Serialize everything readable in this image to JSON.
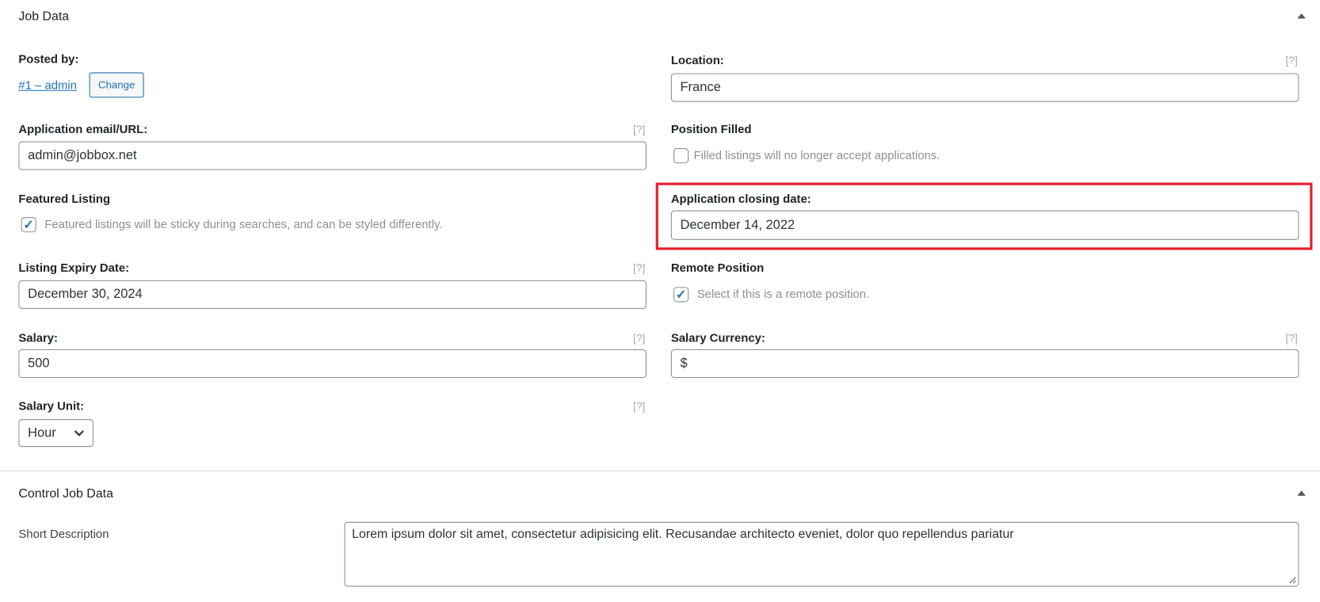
{
  "job_data": {
    "title": "Job Data",
    "posted_by": {
      "label": "Posted by:",
      "user_link": "#1 – admin",
      "change_button": "Change"
    },
    "location": {
      "label": "Location:",
      "help": "[?]",
      "value": "France"
    },
    "application": {
      "label": "Application email/URL:",
      "help": "[?]",
      "value": "admin@jobbox.net"
    },
    "position_filled": {
      "label": "Position Filled",
      "checked": false,
      "description": "Filled listings will no longer accept applications."
    },
    "featured": {
      "label": "Featured Listing",
      "checked": true,
      "description": "Featured listings will be sticky during searches, and can be styled differently."
    },
    "closing_date": {
      "label": "Application closing date:",
      "value": "December 14, 2022",
      "highlight_color": "#e8202a"
    },
    "expiry": {
      "label": "Listing Expiry Date:",
      "help": "[?]",
      "value": "December 30, 2024"
    },
    "remote": {
      "label": "Remote Position",
      "checked": true,
      "description": "Select if this is a remote position."
    },
    "salary": {
      "label": "Salary:",
      "help": "[?]",
      "value": "500"
    },
    "currency": {
      "label": "Salary Currency:",
      "help": "[?]",
      "value": "$"
    },
    "unit": {
      "label": "Salary Unit:",
      "help": "[?]",
      "value": "Hour"
    }
  },
  "control_job_data": {
    "title": "Control Job Data",
    "short_description": {
      "label": "Short Description",
      "value": "Lorem ipsum dolor sit amet, consectetur adipisicing elit. Recusandae architecto eveniet, dolor quo repellendus pariatur"
    }
  }
}
